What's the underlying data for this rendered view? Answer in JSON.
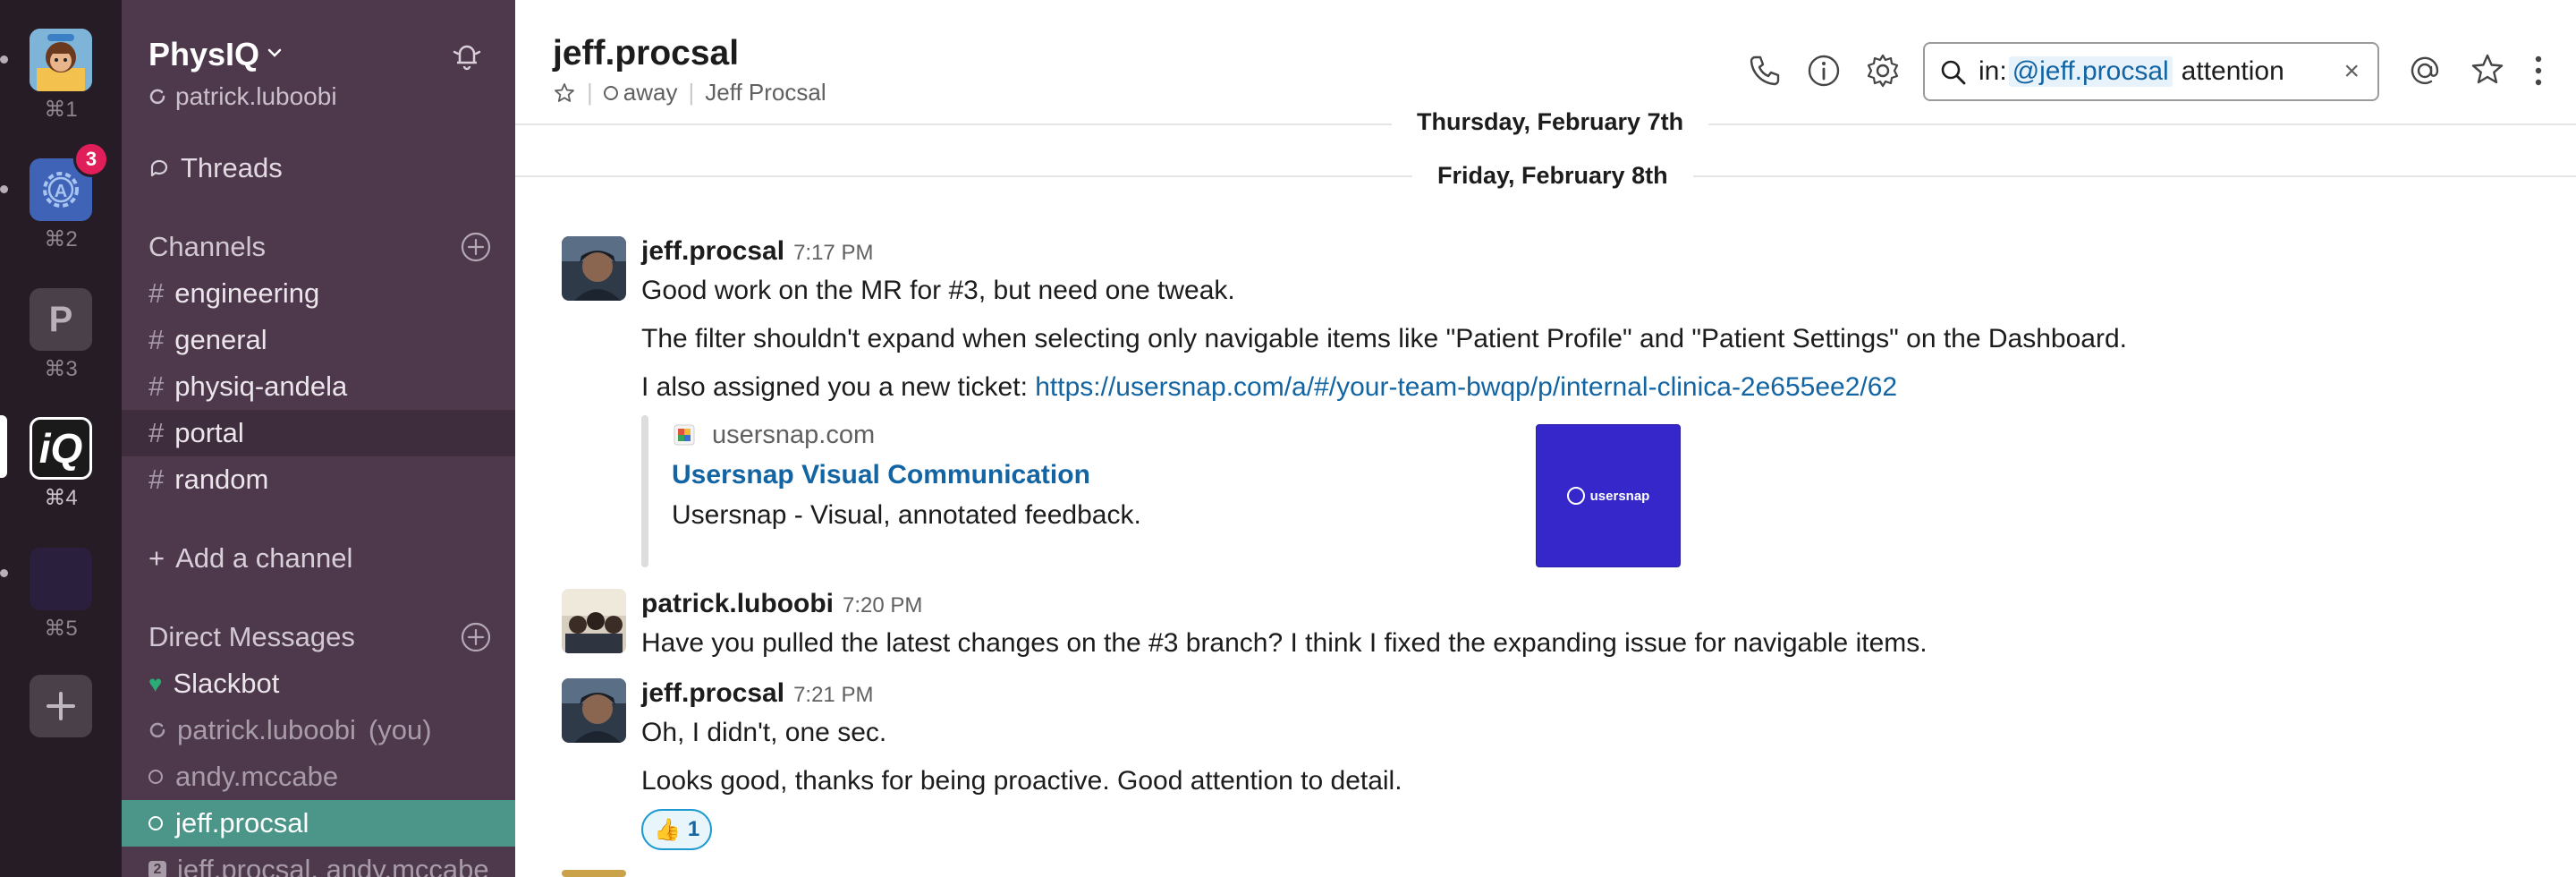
{
  "workspaces": [
    {
      "key": "⌘1",
      "kind": "avatar-girl",
      "color": "#7fb4d9"
    },
    {
      "key": "⌘2",
      "kind": "gear-a",
      "color": "#3f63b6",
      "badge": "3"
    },
    {
      "key": "⌘3",
      "kind": "letter",
      "letter": "P",
      "color": "#4a404a"
    },
    {
      "key": "⌘4",
      "kind": "iq",
      "letter": "iQ",
      "color": "#1a1a1a"
    },
    {
      "key": "⌘5",
      "kind": "dark",
      "color": "#2a1f3d"
    }
  ],
  "sidebar": {
    "team_name": "PhysIQ",
    "current_user": "patrick.luboobi",
    "threads_label": "Threads",
    "channels_header": "Channels",
    "channels": [
      "engineering",
      "general",
      "physiq-andela",
      "portal",
      "random"
    ],
    "add_channel_label": "Add a channel",
    "dm_header": "Direct Messages",
    "dms": [
      {
        "name": "Slackbot"
      },
      {
        "name": "patrick.luboobi",
        "suffix": "(you)"
      },
      {
        "name": "andy.mccabe"
      },
      {
        "name": "jeff.procsal"
      },
      {
        "name": "jeff.procsal, andy.mccabe"
      }
    ]
  },
  "header": {
    "channel_name": "jeff.procsal",
    "status": "away",
    "full_name": "Jeff Procsal",
    "search": {
      "prefix": "in:",
      "token": "@jeff.procsal",
      "query": "attention",
      "clear": "×"
    }
  },
  "dividers": {
    "first": "Thursday, February 7th",
    "second": "Friday, February 8th"
  },
  "messages": [
    {
      "author": "jeff.procsal",
      "time": "7:17 PM",
      "lines": [
        "Good work on the MR for #3, but need one tweak.",
        "The filter shouldn't expand when selecting only navigable items like \"Patient Profile\" and \"Patient Settings\" on the Dashboard."
      ],
      "line3_prefix": "I also assigned you a new ticket: ",
      "line3_link": "https://usersnap.com/a/#/your-team-bwqp/p/internal-clinica-2e655ee2/62",
      "unfurl": {
        "site": "usersnap.com",
        "title": "Usersnap Visual Communication",
        "description": "Usersnap - Visual, annotated feedback.",
        "thumb_text": "usersnap"
      }
    },
    {
      "author": "patrick.luboobi",
      "time": "7:20 PM",
      "lines": [
        "Have you pulled the latest changes on the #3 branch? I think I fixed the expanding issue for navigable items."
      ]
    },
    {
      "author": "jeff.procsal",
      "time": "7:21 PM",
      "lines": [
        "Oh, I didn't, one sec.",
        "Looks good, thanks for being proactive. Good attention to detail."
      ],
      "reaction": {
        "emoji": "👍",
        "count": "1"
      }
    }
  ],
  "colors": {
    "sidebar_bg": "#4d394b",
    "workspace_bg": "#261c26",
    "active_item": "#4c9689",
    "link": "#1264a3",
    "badge": "#e01e5a"
  }
}
